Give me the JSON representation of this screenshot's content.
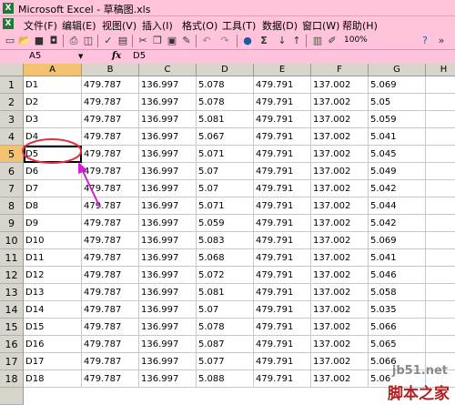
{
  "window": {
    "title": "Microsoft Excel - 草稿图.xls",
    "app_icon": "X"
  },
  "menu": [
    "文件(F)",
    "编辑(E)",
    "视图(V)",
    "插入(I)",
    "格式(O)",
    "工具(T)",
    "数据(D)",
    "窗口(W)",
    "帮助(H)"
  ],
  "toolbar": {
    "zoom": "100%"
  },
  "formula_bar": {
    "name_box": "A5",
    "fx": "fx",
    "value": "D5"
  },
  "columns": [
    "A",
    "B",
    "C",
    "D",
    "E",
    "F",
    "G",
    "H"
  ],
  "rows": [
    {
      "num": "1",
      "cells": [
        "D1",
        "479.787",
        "136.997",
        "5.078",
        "479.791",
        "137.002",
        "5.069"
      ]
    },
    {
      "num": "2",
      "cells": [
        "D2",
        "479.787",
        "136.997",
        "5.078",
        "479.791",
        "137.002",
        "5.05"
      ]
    },
    {
      "num": "3",
      "cells": [
        "D3",
        "479.787",
        "136.997",
        "5.081",
        "479.791",
        "137.002",
        "5.059"
      ]
    },
    {
      "num": "4",
      "cells": [
        "D4",
        "479.787",
        "136.997",
        "5.067",
        "479.791",
        "137.002",
        "5.041"
      ]
    },
    {
      "num": "5",
      "cells": [
        "D5",
        "479.787",
        "136.997",
        "5.071",
        "479.791",
        "137.002",
        "5.045"
      ]
    },
    {
      "num": "6",
      "cells": [
        "D6",
        "479.787",
        "136.997",
        "5.07",
        "479.791",
        "137.002",
        "5.049"
      ]
    },
    {
      "num": "7",
      "cells": [
        "D7",
        "479.787",
        "136.997",
        "5.07",
        "479.791",
        "137.002",
        "5.042"
      ]
    },
    {
      "num": "8",
      "cells": [
        "D8",
        "479.787",
        "136.997",
        "5.071",
        "479.791",
        "137.002",
        "5.044"
      ]
    },
    {
      "num": "9",
      "cells": [
        "D9",
        "479.787",
        "136.997",
        "5.059",
        "479.791",
        "137.002",
        "5.042"
      ]
    },
    {
      "num": "10",
      "cells": [
        "D10",
        "479.787",
        "136.997",
        "5.083",
        "479.791",
        "137.002",
        "5.069"
      ]
    },
    {
      "num": "11",
      "cells": [
        "D11",
        "479.787",
        "136.997",
        "5.068",
        "479.791",
        "137.002",
        "5.041"
      ]
    },
    {
      "num": "12",
      "cells": [
        "D12",
        "479.787",
        "136.997",
        "5.072",
        "479.791",
        "137.002",
        "5.046"
      ]
    },
    {
      "num": "13",
      "cells": [
        "D13",
        "479.787",
        "136.997",
        "5.081",
        "479.791",
        "137.002",
        "5.058"
      ]
    },
    {
      "num": "14",
      "cells": [
        "D14",
        "479.787",
        "136.997",
        "5.07",
        "479.791",
        "137.002",
        "5.035"
      ]
    },
    {
      "num": "15",
      "cells": [
        "D15",
        "479.787",
        "136.997",
        "5.078",
        "479.791",
        "137.002",
        "5.066"
      ]
    },
    {
      "num": "16",
      "cells": [
        "D16",
        "479.787",
        "136.997",
        "5.087",
        "479.791",
        "137.002",
        "5.065"
      ]
    },
    {
      "num": "17",
      "cells": [
        "D17",
        "479.787",
        "136.997",
        "5.077",
        "479.791",
        "137.002",
        "5.066"
      ]
    },
    {
      "num": "18",
      "cells": [
        "D18",
        "479.787",
        "136.997",
        "5.088",
        "479.791",
        "137.002",
        "5.06"
      ]
    }
  ],
  "active": {
    "row": 5,
    "col": "A"
  },
  "colors": {
    "chrome": "#ffc4dc",
    "header": "#d8d5cd",
    "selected_header": "#f2c270",
    "annotation": "#e03040",
    "arrow": "#d020d0"
  },
  "watermark": {
    "line1": "jb51.net",
    "line2": "脚本之家"
  }
}
